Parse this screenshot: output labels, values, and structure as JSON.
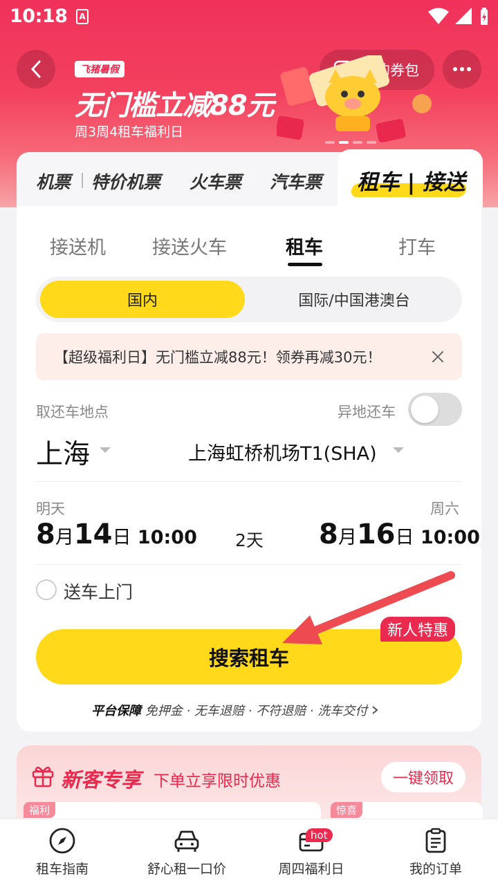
{
  "status_bar": {
    "time": "10:18",
    "app_icon_letter": "A"
  },
  "header": {
    "coupon_label": "我的券包"
  },
  "promo": {
    "tag": "飞猪暑假",
    "title": "无门槛立减88元",
    "subtitle": "周3周4租车福利日",
    "carousel_index": 1,
    "carousel_count": 4
  },
  "categories": {
    "items": [
      "机票",
      "特价机票",
      "火车票",
      "汽车票"
    ],
    "active": "租车 | 接送"
  },
  "subtabs": {
    "items": [
      "接送机",
      "接送火车",
      "租车",
      "打车"
    ],
    "active_index": 2
  },
  "region": {
    "domestic": "国内",
    "international": "国际/中国港澳台",
    "selected": "国内"
  },
  "notice": {
    "text": "【超级福利日】无门槛立减88元！领券再减30元！"
  },
  "pickup": {
    "label": "取还车地点",
    "return_elsewhere_label": "异地还车",
    "return_elsewhere_on": false,
    "city": "上海",
    "location": "上海虹桥机场T1(SHA)"
  },
  "dates": {
    "start_day": "明天",
    "start_month": "8",
    "month_unit": "月",
    "start_date": "14",
    "day_unit": "日",
    "start_time": "10:00",
    "duration": "2天",
    "end_day": "周六",
    "end_month": "8",
    "end_date": "16",
    "end_time": "10:00"
  },
  "delivery": {
    "label": "送车上门",
    "checked": false
  },
  "search": {
    "label": "搜索租车",
    "badge": "新人特惠"
  },
  "guarantee": {
    "prefix": "平台保障",
    "text": "免押金 · 无车退赔 · 不符退赔 · 洗车交付"
  },
  "new_customer": {
    "title": "新客专享",
    "subtitle": "下单立享限时优惠",
    "button": "一键领取",
    "tag1": "福利",
    "tag2": "惊喜"
  },
  "bottom_nav": {
    "items": [
      {
        "label": "租车指南",
        "icon": "compass-icon"
      },
      {
        "label": "舒心租一口价",
        "icon": "car-icon"
      },
      {
        "label": "周四福利日",
        "icon": "card-icon",
        "badge": "hot"
      },
      {
        "label": "我的订单",
        "icon": "clipboard-icon"
      }
    ]
  },
  "colors": {
    "brand_yellow": "#ffd91a",
    "brand_red": "#ea2a4e",
    "banner_red": "#f0315a"
  }
}
